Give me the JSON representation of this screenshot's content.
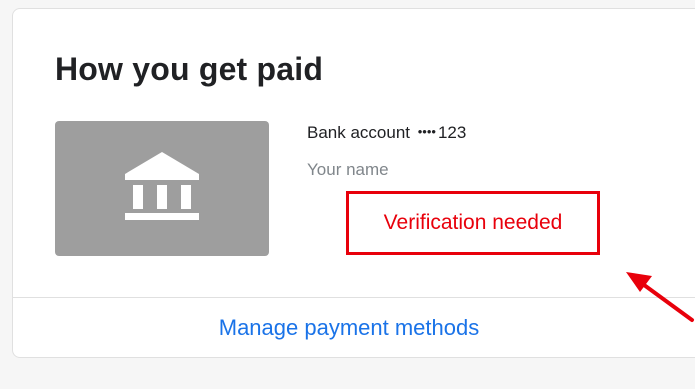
{
  "card": {
    "title": "How you get paid",
    "bank": {
      "icon": "bank-icon",
      "account_label": "Bank account",
      "mask": "••••",
      "last_digits": "123",
      "holder_name": "Your name"
    },
    "verification": {
      "status_text": "Verification needed",
      "highlight_color": "#e8000b"
    },
    "manage_link_label": "Manage payment methods"
  },
  "colors": {
    "link": "#1a73e8",
    "tile": "#9e9e9e",
    "annotation": "#e8000b"
  },
  "annotation": {
    "icon": "arrow-annotation"
  }
}
